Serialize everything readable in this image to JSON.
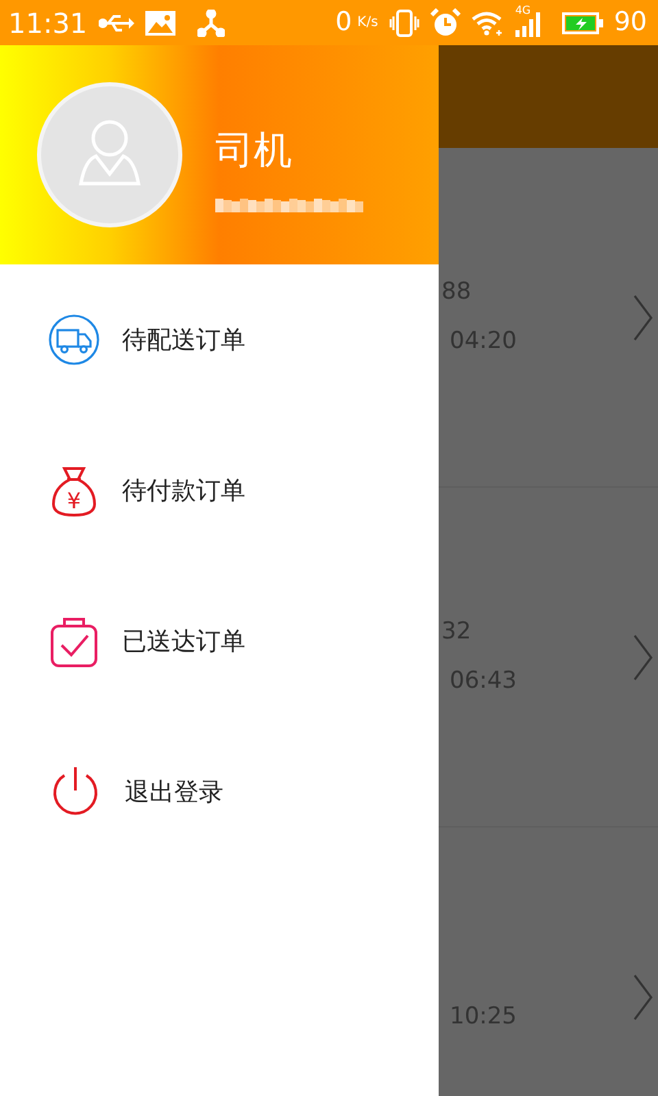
{
  "status_bar": {
    "time": "11:31",
    "net_speed": "0",
    "net_speed_unit": "K/s",
    "network_type": "4G",
    "battery": "90",
    "battery_charging": true
  },
  "drawer": {
    "user_name": "司机",
    "menu": [
      {
        "label": "待配送订单",
        "kind": "truck"
      },
      {
        "label": "待付款订单",
        "kind": "moneybag",
        "glyph": "¥"
      },
      {
        "label": "已送达订单",
        "kind": "delivered"
      },
      {
        "label": "退出登录",
        "kind": "power"
      }
    ]
  },
  "background_list": {
    "rows": [
      {
        "line_1": "88",
        "line_2": "04:20"
      },
      {
        "line_1": "32",
        "line_2": "06:43"
      },
      {
        "line_2": "10:25"
      }
    ]
  }
}
